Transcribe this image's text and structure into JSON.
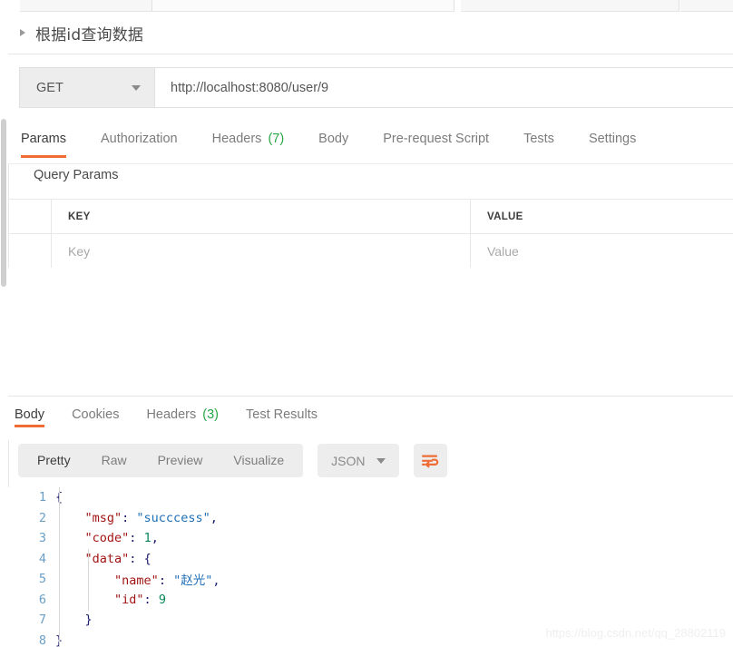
{
  "window": {
    "app": "Postman",
    "top_tabs_placeholder": ""
  },
  "request": {
    "name": "根据id查询数据",
    "disclosure_icon": "triangle-right-icon",
    "method": "GET",
    "method_caret_icon": "chevron-down-icon",
    "url": "http://localhost:8080/user/9"
  },
  "request_tabs": [
    {
      "label": "Params",
      "count": "",
      "active": true
    },
    {
      "label": "Authorization",
      "count": "",
      "active": false
    },
    {
      "label": "Headers",
      "count": "(7)",
      "active": false
    },
    {
      "label": "Body",
      "count": "",
      "active": false
    },
    {
      "label": "Pre-request Script",
      "count": "",
      "active": false
    },
    {
      "label": "Tests",
      "count": "",
      "active": false
    },
    {
      "label": "Settings",
      "count": "",
      "active": false
    }
  ],
  "query_params": {
    "section_label": "Query Params",
    "columns": [
      "KEY",
      "VALUE"
    ],
    "rows": [
      {
        "key_placeholder": "Key",
        "value_placeholder": "Value"
      }
    ]
  },
  "response_tabs": [
    {
      "label": "Body",
      "count": "",
      "active": true
    },
    {
      "label": "Cookies",
      "count": "",
      "active": false
    },
    {
      "label": "Headers",
      "count": "(3)",
      "active": false
    },
    {
      "label": "Test Results",
      "count": "",
      "active": false
    }
  ],
  "body_toolbar": {
    "views": [
      {
        "label": "Pretty",
        "active": true
      },
      {
        "label": "Raw",
        "active": false
      },
      {
        "label": "Preview",
        "active": false
      },
      {
        "label": "Visualize",
        "active": false
      }
    ],
    "language": "JSON",
    "language_caret_icon": "chevron-down-icon",
    "wrap_icon": "word-wrap-icon"
  },
  "response_body": {
    "format": "json",
    "lines": [
      {
        "n": "1",
        "indent": 0,
        "tokens": [
          {
            "t": "{",
            "c": "k-brace"
          }
        ]
      },
      {
        "n": "2",
        "indent": 1,
        "tokens": [
          {
            "t": "\"msg\"",
            "c": "k-key"
          },
          {
            "t": ": ",
            "c": "k-pun"
          },
          {
            "t": "\"succcess\"",
            "c": "k-str"
          },
          {
            "t": ",",
            "c": "k-pun"
          }
        ]
      },
      {
        "n": "3",
        "indent": 1,
        "tokens": [
          {
            "t": "\"code\"",
            "c": "k-key"
          },
          {
            "t": ": ",
            "c": "k-pun"
          },
          {
            "t": "1",
            "c": "k-num"
          },
          {
            "t": ",",
            "c": "k-pun"
          }
        ]
      },
      {
        "n": "4",
        "indent": 1,
        "tokens": [
          {
            "t": "\"data\"",
            "c": "k-key"
          },
          {
            "t": ": ",
            "c": "k-pun"
          },
          {
            "t": "{",
            "c": "k-brace"
          }
        ]
      },
      {
        "n": "5",
        "indent": 2,
        "tokens": [
          {
            "t": "\"name\"",
            "c": "k-key"
          },
          {
            "t": ": ",
            "c": "k-pun"
          },
          {
            "t": "\"赵光\"",
            "c": "k-str"
          },
          {
            "t": ",",
            "c": "k-pun"
          }
        ]
      },
      {
        "n": "6",
        "indent": 2,
        "tokens": [
          {
            "t": "\"id\"",
            "c": "k-key"
          },
          {
            "t": ": ",
            "c": "k-pun"
          },
          {
            "t": "9",
            "c": "k-num"
          }
        ]
      },
      {
        "n": "7",
        "indent": 1,
        "tokens": [
          {
            "t": "}",
            "c": "k-brace"
          }
        ]
      },
      {
        "n": "8",
        "indent": 0,
        "tokens": [
          {
            "t": "}",
            "c": "k-brace"
          }
        ]
      }
    ]
  },
  "watermark": "https://blog.csdn.net/qq_28802119",
  "colors": {
    "accent": "#ef6c34",
    "count_green": "#28a745",
    "json_key": "#a31515",
    "json_string": "#1f6fb8",
    "json_number": "#098658",
    "gutter_number": "#6a9ec4"
  }
}
